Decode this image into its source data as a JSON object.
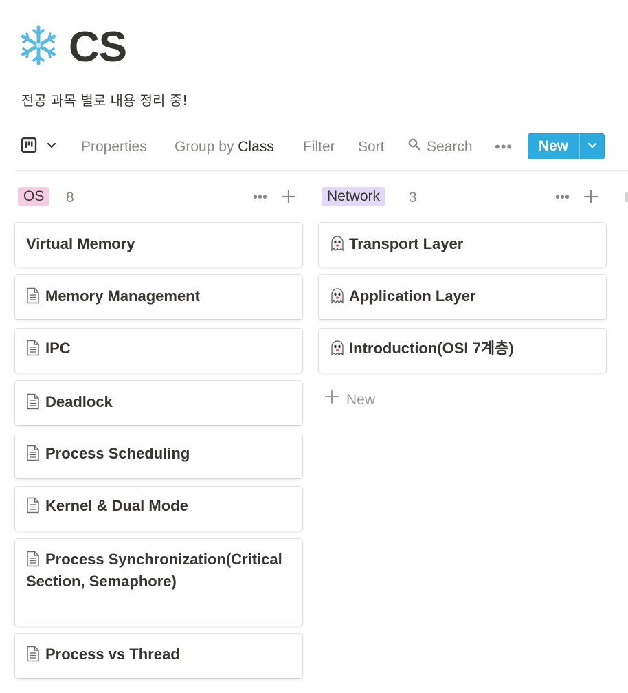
{
  "page": {
    "icon": "snowflake-icon",
    "title": "CS",
    "description": "전공 과목 별로 내용 정리 중!"
  },
  "toolbar": {
    "view_icon": "board-view-icon",
    "properties": "Properties",
    "group_by_prefix": "Group by",
    "group_by_value": "Class",
    "filter": "Filter",
    "sort": "Sort",
    "search": "Search",
    "more": "•••",
    "new_label": "New"
  },
  "columns": [
    {
      "name": "OS",
      "count": "8",
      "tag_color": "#f5cde2",
      "cards": [
        {
          "title": "Virtual Memory",
          "icon": "none"
        },
        {
          "title": "Memory Management",
          "icon": "document-icon"
        },
        {
          "title": "IPC",
          "icon": "document-icon"
        },
        {
          "title": "Deadlock",
          "icon": "document-icon"
        },
        {
          "title": "Process Scheduling",
          "icon": "document-icon"
        },
        {
          "title": "Kernel & Dual Mode",
          "icon": "document-icon"
        },
        {
          "title": "Process Synchronization(Critical Section, Semaphore)",
          "icon": "document-icon"
        },
        {
          "title": "Process vs Thread",
          "icon": "document-icon"
        }
      ]
    },
    {
      "name": "Network",
      "count": "3",
      "tag_color": "#e2d9f6",
      "cards": [
        {
          "title": "Transport Layer",
          "icon": "ghost-icon"
        },
        {
          "title": "Application Layer",
          "icon": "ghost-icon"
        },
        {
          "title": "Introduction(OSI 7계층)",
          "icon": "ghost-icon"
        }
      ],
      "add_new_label": "New"
    }
  ],
  "colors": {
    "accent": "#2eaadc",
    "text": "#37352f",
    "muted": "#8a8985"
  }
}
